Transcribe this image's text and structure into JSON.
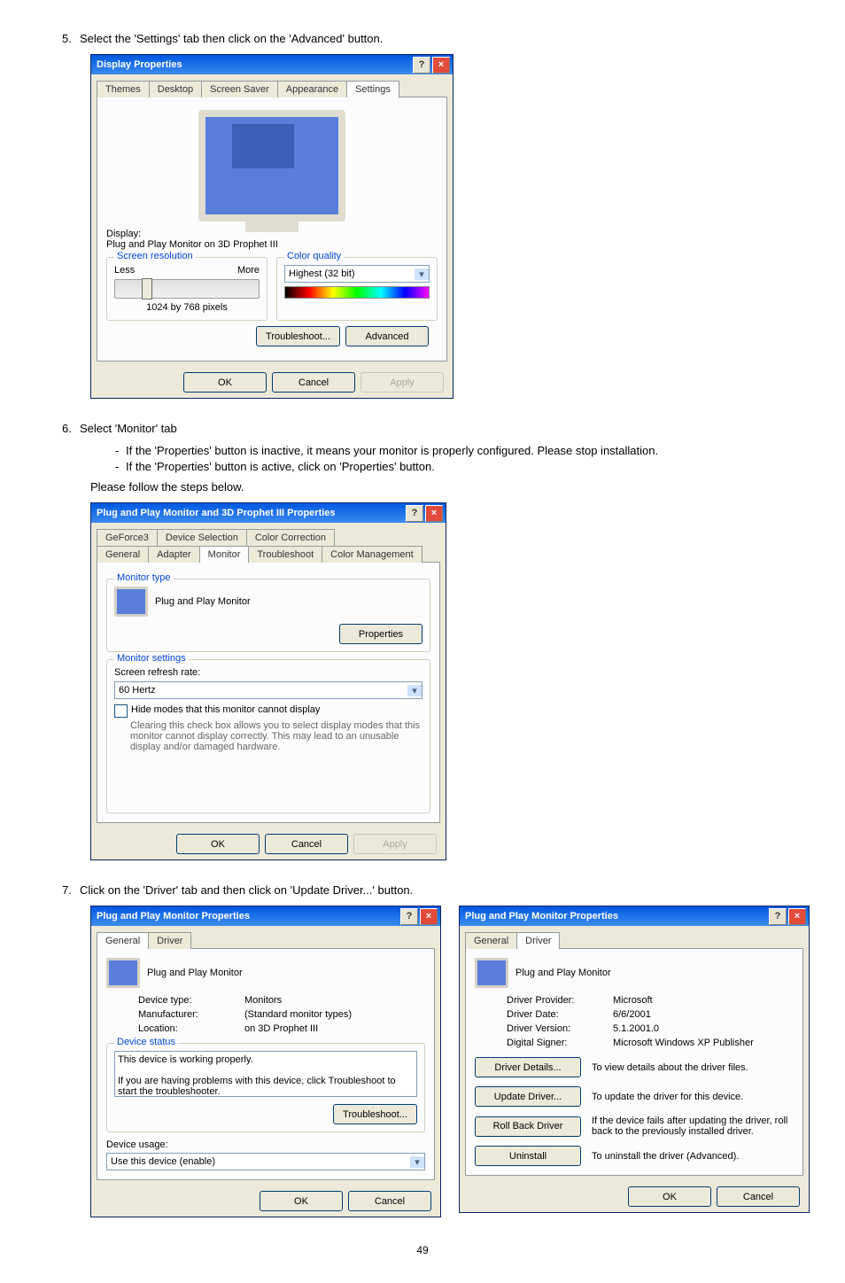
{
  "step5": {
    "num": "5.",
    "text": "Select the 'Settings' tab then click on the 'Advanced' button."
  },
  "step6": {
    "num": "6.",
    "text": "Select 'Monitor' tab"
  },
  "step6a": "If the 'Properties' button is inactive, it means your monitor is properly configured. Please stop installation.",
  "step6b": "If the 'Properties' button is active, click on 'Properties' button.",
  "step6c": "Please follow the steps below.",
  "step7": {
    "num": "7.",
    "text": "Click on the 'Driver' tab and then click on 'Update Driver...' button."
  },
  "pagenum": "49",
  "dlg1": {
    "title": "Display Properties",
    "tabs": [
      "Themes",
      "Desktop",
      "Screen Saver",
      "Appearance",
      "Settings"
    ],
    "display_label": "Display:",
    "display_name": "Plug and Play Monitor on 3D Prophet III",
    "screen_res": "Screen resolution",
    "less": "Less",
    "more": "More",
    "res_value": "1024 by 768 pixels",
    "color_quality": "Color quality",
    "color_value": "Highest (32 bit)",
    "troubleshoot": "Troubleshoot...",
    "advanced": "Advanced",
    "ok": "OK",
    "cancel": "Cancel",
    "apply": "Apply"
  },
  "dlg2": {
    "title": "Plug and Play Monitor and 3D Prophet III Properties",
    "tabs_top": [
      "GeForce3",
      "Device Selection",
      "Color Correction"
    ],
    "tabs_bot": [
      "General",
      "Adapter",
      "Monitor",
      "Troubleshoot",
      "Color Management"
    ],
    "montype": "Monitor type",
    "monname": "Plug and Play Monitor",
    "properties": "Properties",
    "monsettings": "Monitor settings",
    "refresh_label": "Screen refresh rate:",
    "refresh_value": "60 Hertz",
    "hide": "Hide modes that this monitor cannot display",
    "hide_desc": "Clearing this check box allows you to select display modes that this monitor cannot display correctly. This may lead to an unusable display and/or damaged hardware.",
    "ok": "OK",
    "cancel": "Cancel",
    "apply": "Apply"
  },
  "dlg3": {
    "title": "Plug and Play Monitor Properties",
    "tabs": [
      "General",
      "Driver"
    ],
    "monname": "Plug and Play Monitor",
    "devtype_l": "Device type:",
    "devtype_v": "Monitors",
    "manuf_l": "Manufacturer:",
    "manuf_v": "(Standard monitor types)",
    "loc_l": "Location:",
    "loc_v": "on 3D Prophet III",
    "devstatus": "Device status",
    "status_text": "This device is working properly.",
    "status_hint": "If you are having problems with this device, click Troubleshoot to start the troubleshooter.",
    "troubleshoot": "Troubleshoot...",
    "usage": "Device usage:",
    "usage_val": "Use this device (enable)",
    "ok": "OK",
    "cancel": "Cancel"
  },
  "dlg4": {
    "title": "Plug and Play Monitor Properties",
    "tabs": [
      "General",
      "Driver"
    ],
    "monname": "Plug and Play Monitor",
    "prov_l": "Driver Provider:",
    "prov_v": "Microsoft",
    "date_l": "Driver Date:",
    "date_v": "6/6/2001",
    "ver_l": "Driver Version:",
    "ver_v": "5.1.2001.0",
    "sig_l": "Digital Signer:",
    "sig_v": "Microsoft Windows XP Publisher",
    "details": "Driver Details...",
    "details_d": "To view details about the driver files.",
    "update": "Update Driver...",
    "update_d": "To update the driver for this device.",
    "rollback": "Roll Back Driver",
    "rollback_d": "If the device fails after updating the driver, roll back to the previously installed driver.",
    "uninstall": "Uninstall",
    "uninstall_d": "To uninstall the driver (Advanced).",
    "ok": "OK",
    "cancel": "Cancel"
  }
}
